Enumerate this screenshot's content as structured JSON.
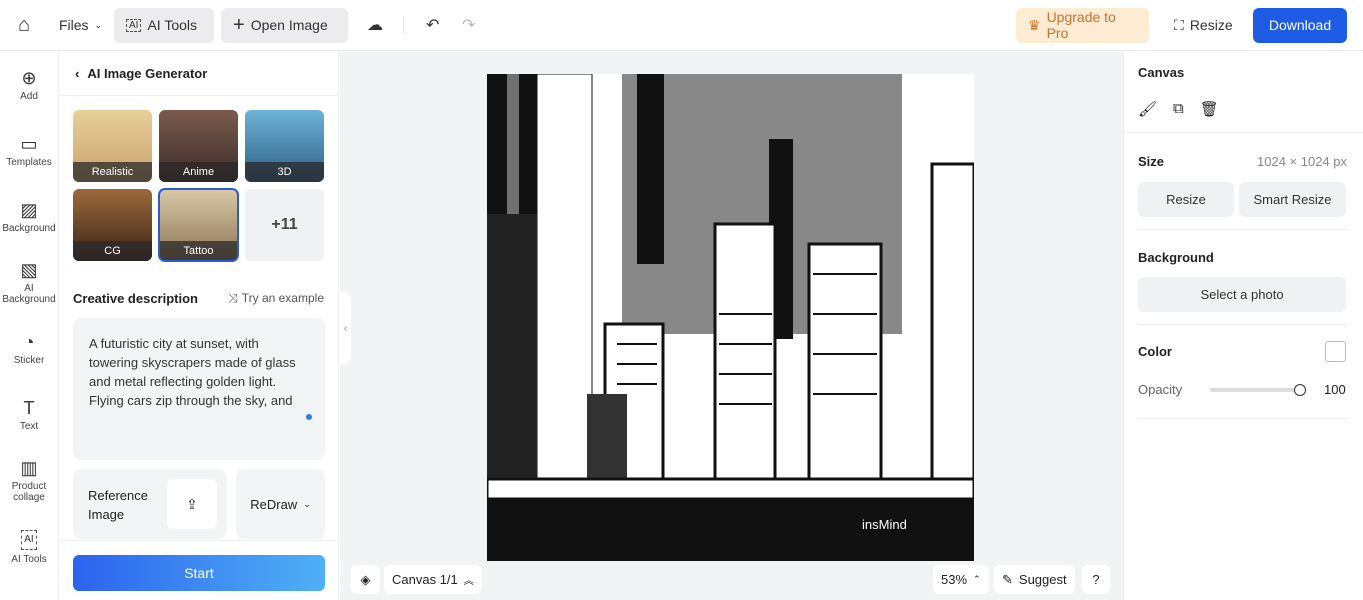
{
  "topbar": {
    "files": "Files",
    "ai_tools": "AI Tools",
    "open_image": "Open Image",
    "upgrade": "Upgrade to Pro",
    "resize": "Resize",
    "download": "Download"
  },
  "sidebar": {
    "items": [
      {
        "label": "Add",
        "icon": "plus-circle-icon"
      },
      {
        "label": "Templates",
        "icon": "templates-icon"
      },
      {
        "label": "Background",
        "icon": "background-icon"
      },
      {
        "label": "AI Background",
        "icon": "ai-background-icon"
      },
      {
        "label": "Sticker",
        "icon": "sticker-icon"
      },
      {
        "label": "Text",
        "icon": "text-icon"
      },
      {
        "label": "Product collage",
        "icon": "collage-icon"
      },
      {
        "label": "AI Tools",
        "icon": "ai-tools-icon"
      }
    ]
  },
  "panel": {
    "title": "AI Image Generator",
    "styles": [
      {
        "label": "Realistic"
      },
      {
        "label": "Anime"
      },
      {
        "label": "3D"
      },
      {
        "label": "CG"
      },
      {
        "label": "Tattoo",
        "selected": true
      }
    ],
    "more": "+11",
    "desc_label": "Creative description",
    "try_example": "Try an example",
    "description": "A futuristic city at sunset, with towering skyscrapers made of glass and metal reflecting golden light. Flying cars zip through the sky, and neon signs glow in vibrant blues",
    "reference_image": "Reference Image",
    "redraw": "ReDraw",
    "start": "Start"
  },
  "canvas": {
    "watermark": "insMind",
    "page": "Canvas 1/1",
    "zoom": "53%",
    "suggest": "Suggest",
    "help": "?"
  },
  "right": {
    "title": "Canvas",
    "size_label": "Size",
    "size_value": "1024 × 1024 px",
    "resize": "Resize",
    "smart_resize": "Smart Resize",
    "background_label": "Background",
    "select_photo": "Select a photo",
    "color_label": "Color",
    "opacity_label": "Opacity",
    "opacity_value": "100"
  },
  "colors": {
    "accent": "#1f5ce6",
    "upgrade_bg": "#fdebd3",
    "upgrade_text": "#c9742a"
  }
}
